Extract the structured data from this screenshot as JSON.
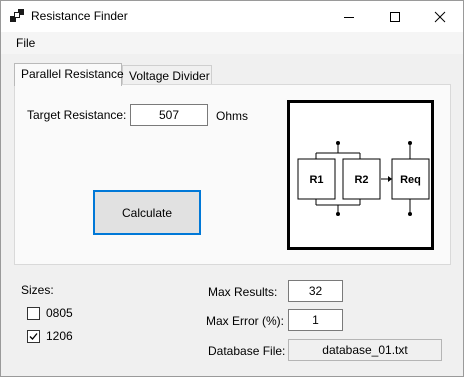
{
  "window": {
    "title": "Resistance Finder"
  },
  "menu": {
    "file": "File"
  },
  "tabs": [
    {
      "label": "Parallel Resistance",
      "active": true
    },
    {
      "label": "Voltage Divider",
      "active": false
    }
  ],
  "parallel": {
    "target_label": "Target Resistance:",
    "target_value": "507",
    "unit": "Ohms",
    "calculate_label": "Calculate",
    "diagram": {
      "r1": "R1",
      "r2": "R2",
      "req": "Req"
    }
  },
  "sizes": {
    "label": "Sizes:",
    "options": [
      {
        "label": "0805",
        "checked": false
      },
      {
        "label": "1206",
        "checked": true
      }
    ]
  },
  "settings": {
    "max_results_label": "Max Results:",
    "max_results_value": "32",
    "max_error_label": "Max Error (%):",
    "max_error_value": "1",
    "database_label": "Database File:",
    "database_value": "database_01.txt"
  },
  "colors": {
    "focus_border": "#0078d7",
    "button_face": "#e1e1e1",
    "window_bg": "#f0f0f0"
  }
}
